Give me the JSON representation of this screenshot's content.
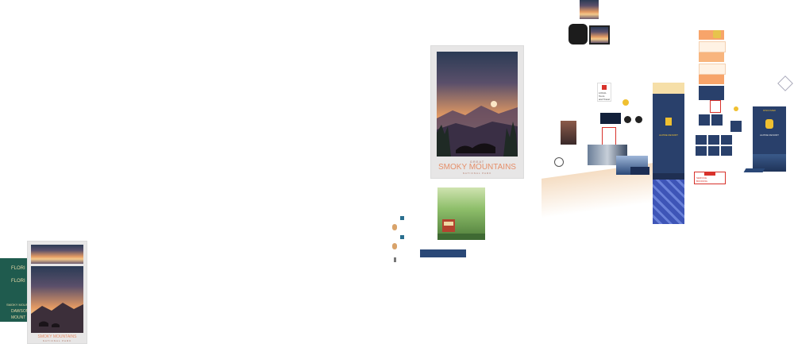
{
  "canvas": {
    "description_tag": "design-board"
  },
  "posters": {
    "main": {
      "kicker": "GREAT",
      "title": "SMOKY MOUNTAINS",
      "subtitle": "NATIONAL PARK"
    },
    "small": {
      "title": "SMOKY MOUNTAINS",
      "subtitle": "NATIONAL PARK"
    }
  },
  "green_panel": {
    "lines": [
      "FLORI",
      "FLORI",
      "SMOKY MOUNT",
      "DAWSON",
      "MOUNT"
    ]
  },
  "cards": {
    "badge_top": {
      "line1": "LOCAL",
      "line2": "Tours",
      "line3": "and Travel"
    },
    "red_tile": {
      "line1": "SERVICE",
      "line2": "BOOKING"
    },
    "banner_top": {
      "text": "Explore"
    },
    "banner_mid": {
      "text": "ALPINE RESORT"
    },
    "banner_right": {
      "text": "DISCOVER"
    }
  },
  "colors": {
    "accent": "#e58f6a",
    "navy": "#29406b",
    "forest": "#4e7c3a",
    "frame": "#e7e6e6"
  }
}
